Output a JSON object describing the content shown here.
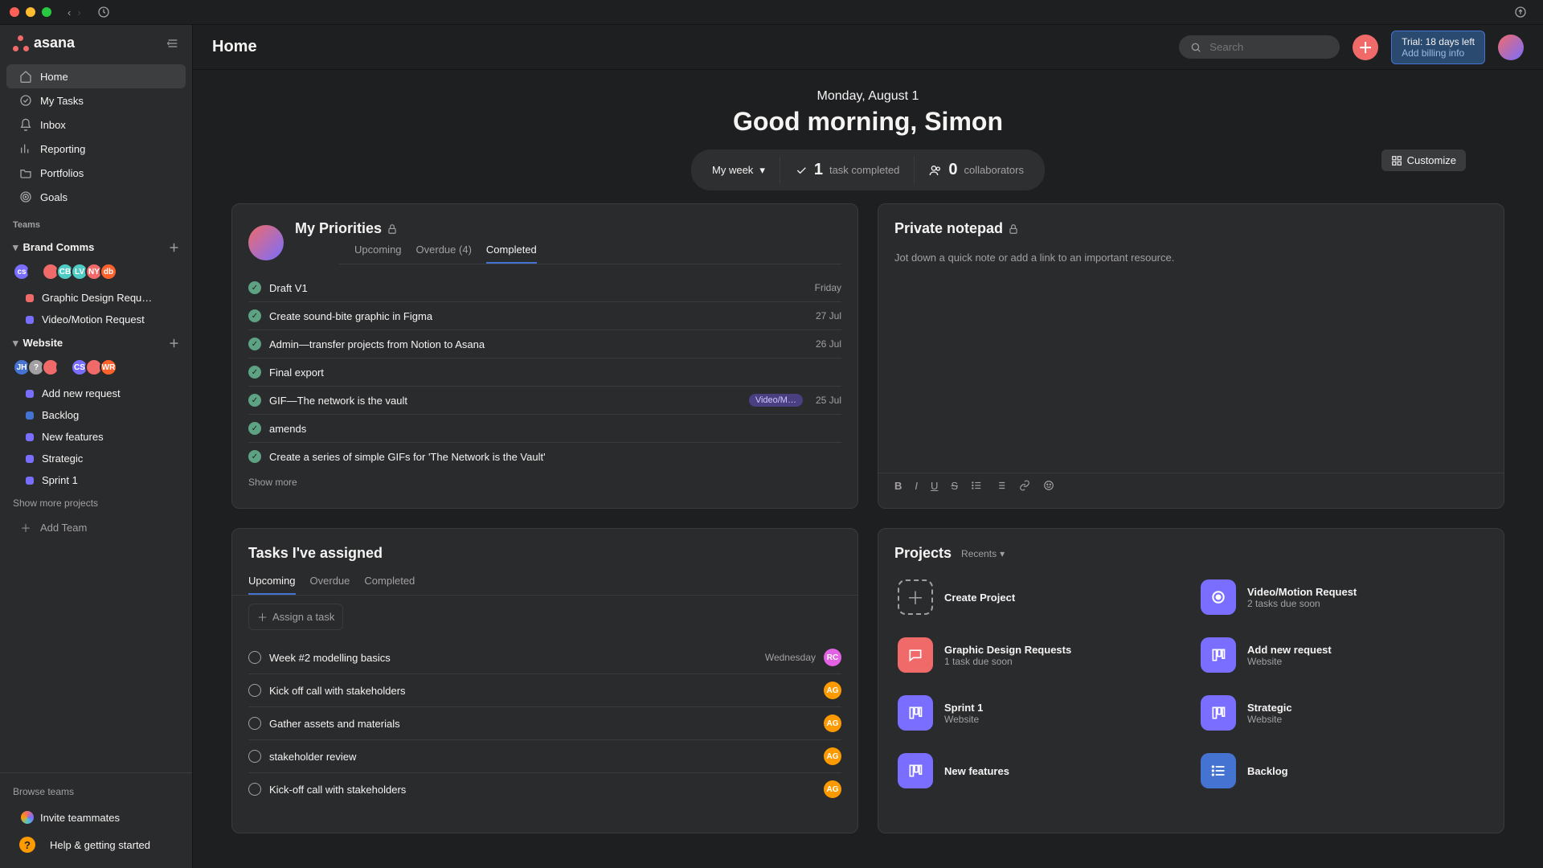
{
  "window": {
    "title": "Home"
  },
  "topbar": {
    "search_placeholder": "Search",
    "trial_line1": "Trial: 18 days left",
    "trial_line2": "Add billing info"
  },
  "sidebar": {
    "logo_text": "asana",
    "nav": [
      {
        "label": "Home",
        "icon": "home",
        "active": true
      },
      {
        "label": "My Tasks",
        "icon": "check"
      },
      {
        "label": "Inbox",
        "icon": "bell"
      },
      {
        "label": "Reporting",
        "icon": "chart"
      },
      {
        "label": "Portfolios",
        "icon": "folder"
      },
      {
        "label": "Goals",
        "icon": "target"
      }
    ],
    "teams_heading": "Teams",
    "teams": [
      {
        "name": "Brand Comms",
        "avatars": [
          {
            "txt": "cs",
            "bg": "#796eff"
          },
          {
            "txt": "",
            "bg": "#2a2b2d",
            "img": true
          },
          {
            "txt": "",
            "bg": "#f06a6a",
            "img": true
          },
          {
            "txt": "CB",
            "bg": "#4ecbc4"
          },
          {
            "txt": "LV",
            "bg": "#4ecbc4"
          },
          {
            "txt": "NY",
            "bg": "#f06a6a"
          },
          {
            "txt": "db",
            "bg": "#fd612c"
          }
        ],
        "projects": [
          {
            "name": "Graphic Design Requ…",
            "color": "#f06a6a"
          },
          {
            "name": "Video/Motion Request",
            "color": "#796eff"
          }
        ]
      },
      {
        "name": "Website",
        "avatars": [
          {
            "txt": "JH",
            "bg": "#4573d2"
          },
          {
            "txt": "?",
            "bg": "#a2a0a2"
          },
          {
            "txt": "",
            "bg": "#f06a6a",
            "img": true
          },
          {
            "txt": "",
            "bg": "#2a2b2d",
            "img": true
          },
          {
            "txt": "CS",
            "bg": "#796eff"
          },
          {
            "txt": "",
            "bg": "#f06a6a",
            "img": true
          },
          {
            "txt": "WR",
            "bg": "#fd612c"
          }
        ],
        "projects": [
          {
            "name": "Add new request",
            "color": "#796eff"
          },
          {
            "name": "Backlog",
            "color": "#4573d2"
          },
          {
            "name": "New features",
            "color": "#796eff"
          },
          {
            "name": "Strategic",
            "color": "#796eff"
          },
          {
            "name": "Sprint 1",
            "color": "#796eff"
          }
        ]
      }
    ],
    "show_more_projects": "Show more projects",
    "add_team": "Add Team",
    "browse_teams": "Browse teams",
    "invite": "Invite teammates",
    "help": "Help & getting started"
  },
  "greeting": {
    "date": "Monday, August 1",
    "line": "Good morning, Simon",
    "week_filter": "My week",
    "tasks_completed_count": "1",
    "tasks_completed_label": "task completed",
    "collab_count": "0",
    "collab_label": "collaborators",
    "customize": "Customize"
  },
  "priorities": {
    "title": "My Priorities",
    "tabs": [
      "Upcoming",
      "Overdue (4)",
      "Completed"
    ],
    "active_tab": 2,
    "tasks": [
      {
        "name": "Draft V1",
        "date": "Friday"
      },
      {
        "name": "Create sound-bite graphic in Figma",
        "date": "27 Jul"
      },
      {
        "name": "Admin—transfer projects from Notion to Asana",
        "date": "26 Jul"
      },
      {
        "name": "Final export",
        "date": ""
      },
      {
        "name": "GIF—The network is the vault",
        "date": "25 Jul",
        "tag": "Video/M…"
      },
      {
        "name": "amends",
        "date": ""
      },
      {
        "name": "Create a series of simple GIFs for 'The Network is the Vault'",
        "date": ""
      }
    ],
    "show_more": "Show more"
  },
  "notepad": {
    "title": "Private notepad",
    "placeholder": "Jot down a quick note or add a link to an important resource."
  },
  "assigned": {
    "title": "Tasks I've assigned",
    "tabs": [
      "Upcoming",
      "Overdue",
      "Completed"
    ],
    "active_tab": 0,
    "assign_cta": "Assign a task",
    "tasks": [
      {
        "name": "Week #2 modelling basics",
        "date": "Wednesday",
        "assignee": {
          "txt": "RC",
          "bg": "#e362e3"
        }
      },
      {
        "name": "Kick off call with stakeholders",
        "date": "",
        "assignee": {
          "txt": "AG",
          "bg": "#fd9a00"
        }
      },
      {
        "name": "Gather assets and materials",
        "date": "",
        "assignee": {
          "txt": "AG",
          "bg": "#fd9a00"
        }
      },
      {
        "name": "stakeholder review",
        "date": "",
        "assignee": {
          "txt": "AG",
          "bg": "#fd9a00"
        }
      },
      {
        "name": "Kick-off call with stakeholders",
        "date": "",
        "assignee": {
          "txt": "AG",
          "bg": "#fd9a00"
        }
      }
    ]
  },
  "projects": {
    "title": "Projects",
    "recents_label": "Recents",
    "items": [
      {
        "name": "Create Project",
        "sub": "",
        "icon": "plus",
        "bg": "dashed"
      },
      {
        "name": "Video/Motion Request",
        "sub": "2 tasks due soon",
        "icon": "record",
        "bg": "#796eff"
      },
      {
        "name": "Graphic Design Requests",
        "sub": "1 task due soon",
        "icon": "chat",
        "bg": "#f06a6a"
      },
      {
        "name": "Add new request",
        "sub": "Website",
        "icon": "board",
        "bg": "#796eff"
      },
      {
        "name": "Sprint 1",
        "sub": "Website",
        "icon": "board",
        "bg": "#796eff"
      },
      {
        "name": "Strategic",
        "sub": "Website",
        "icon": "board",
        "bg": "#796eff"
      },
      {
        "name": "New features",
        "sub": "",
        "icon": "board",
        "bg": "#796eff"
      },
      {
        "name": "Backlog",
        "sub": "",
        "icon": "list",
        "bg": "#4573d2"
      }
    ]
  }
}
